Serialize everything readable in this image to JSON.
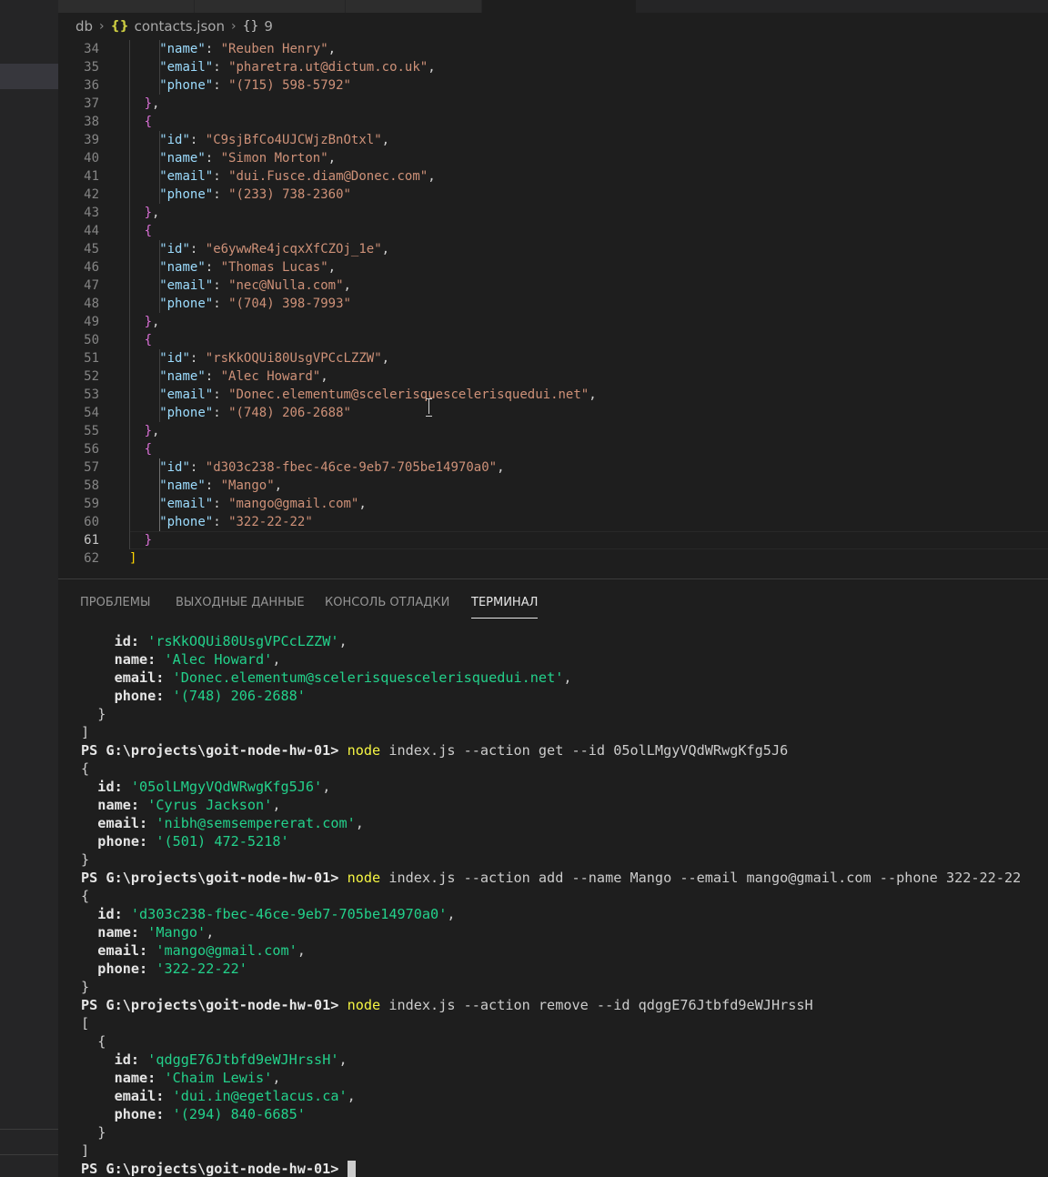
{
  "breadcrumb": {
    "folder": "db",
    "file_icon": "{}",
    "file": "contacts.json",
    "obj_icon": "{}",
    "node": "9"
  },
  "editor": {
    "lines": [
      {
        "n": "34",
        "indent": 4,
        "parts": [
          [
            "k",
            "\"name\""
          ],
          [
            "p",
            ": "
          ],
          [
            "s",
            "\"Reuben Henry\""
          ],
          [
            "p",
            ","
          ]
        ]
      },
      {
        "n": "35",
        "indent": 4,
        "parts": [
          [
            "k",
            "\"email\""
          ],
          [
            "p",
            ": "
          ],
          [
            "s",
            "\"pharetra.ut@dictum.co.uk\""
          ],
          [
            "p",
            ","
          ]
        ]
      },
      {
        "n": "36",
        "indent": 4,
        "parts": [
          [
            "k",
            "\"phone\""
          ],
          [
            "p",
            ": "
          ],
          [
            "s",
            "\"(715) 598-5792\""
          ]
        ]
      },
      {
        "n": "37",
        "indent": 2,
        "parts": [
          [
            "b2",
            "}"
          ],
          [
            "p",
            ","
          ]
        ]
      },
      {
        "n": "38",
        "indent": 2,
        "parts": [
          [
            "b2",
            "{"
          ]
        ]
      },
      {
        "n": "39",
        "indent": 4,
        "parts": [
          [
            "k",
            "\"id\""
          ],
          [
            "p",
            ": "
          ],
          [
            "s",
            "\"C9sjBfCo4UJCWjzBnOtxl\""
          ],
          [
            "p",
            ","
          ]
        ]
      },
      {
        "n": "40",
        "indent": 4,
        "parts": [
          [
            "k",
            "\"name\""
          ],
          [
            "p",
            ": "
          ],
          [
            "s",
            "\"Simon Morton\""
          ],
          [
            "p",
            ","
          ]
        ]
      },
      {
        "n": "41",
        "indent": 4,
        "parts": [
          [
            "k",
            "\"email\""
          ],
          [
            "p",
            ": "
          ],
          [
            "s",
            "\"dui.Fusce.diam@Donec.com\""
          ],
          [
            "p",
            ","
          ]
        ]
      },
      {
        "n": "42",
        "indent": 4,
        "parts": [
          [
            "k",
            "\"phone\""
          ],
          [
            "p",
            ": "
          ],
          [
            "s",
            "\"(233) 738-2360\""
          ]
        ]
      },
      {
        "n": "43",
        "indent": 2,
        "parts": [
          [
            "b2",
            "}"
          ],
          [
            "p",
            ","
          ]
        ]
      },
      {
        "n": "44",
        "indent": 2,
        "parts": [
          [
            "b2",
            "{"
          ]
        ]
      },
      {
        "n": "45",
        "indent": 4,
        "parts": [
          [
            "k",
            "\"id\""
          ],
          [
            "p",
            ": "
          ],
          [
            "s",
            "\"e6ywwRe4jcqxXfCZOj_1e\""
          ],
          [
            "p",
            ","
          ]
        ]
      },
      {
        "n": "46",
        "indent": 4,
        "parts": [
          [
            "k",
            "\"name\""
          ],
          [
            "p",
            ": "
          ],
          [
            "s",
            "\"Thomas Lucas\""
          ],
          [
            "p",
            ","
          ]
        ]
      },
      {
        "n": "47",
        "indent": 4,
        "parts": [
          [
            "k",
            "\"email\""
          ],
          [
            "p",
            ": "
          ],
          [
            "s",
            "\"nec@Nulla.com\""
          ],
          [
            "p",
            ","
          ]
        ]
      },
      {
        "n": "48",
        "indent": 4,
        "parts": [
          [
            "k",
            "\"phone\""
          ],
          [
            "p",
            ": "
          ],
          [
            "s",
            "\"(704) 398-7993\""
          ]
        ]
      },
      {
        "n": "49",
        "indent": 2,
        "parts": [
          [
            "b2",
            "}"
          ],
          [
            "p",
            ","
          ]
        ]
      },
      {
        "n": "50",
        "indent": 2,
        "parts": [
          [
            "b2",
            "{"
          ]
        ]
      },
      {
        "n": "51",
        "indent": 4,
        "parts": [
          [
            "k",
            "\"id\""
          ],
          [
            "p",
            ": "
          ],
          [
            "s",
            "\"rsKkOQUi80UsgVPCcLZZW\""
          ],
          [
            "p",
            ","
          ]
        ]
      },
      {
        "n": "52",
        "indent": 4,
        "parts": [
          [
            "k",
            "\"name\""
          ],
          [
            "p",
            ": "
          ],
          [
            "s",
            "\"Alec Howard\""
          ],
          [
            "p",
            ","
          ]
        ]
      },
      {
        "n": "53",
        "indent": 4,
        "parts": [
          [
            "k",
            "\"email\""
          ],
          [
            "p",
            ": "
          ],
          [
            "s",
            "\"Donec.elementum@scelerisquescelerisquedui.net\""
          ],
          [
            "p",
            ","
          ]
        ]
      },
      {
        "n": "54",
        "indent": 4,
        "parts": [
          [
            "k",
            "\"phone\""
          ],
          [
            "p",
            ": "
          ],
          [
            "s",
            "\"(748) 206-2688\""
          ]
        ]
      },
      {
        "n": "55",
        "indent": 2,
        "parts": [
          [
            "b2",
            "}"
          ],
          [
            "p",
            ","
          ]
        ]
      },
      {
        "n": "56",
        "indent": 2,
        "parts": [
          [
            "b2",
            "{"
          ]
        ]
      },
      {
        "n": "57",
        "indent": 4,
        "parts": [
          [
            "k",
            "\"id\""
          ],
          [
            "p",
            ": "
          ],
          [
            "s",
            "\"d303c238-fbec-46ce-9eb7-705be14970a0\""
          ],
          [
            "p",
            ","
          ]
        ]
      },
      {
        "n": "58",
        "indent": 4,
        "parts": [
          [
            "k",
            "\"name\""
          ],
          [
            "p",
            ": "
          ],
          [
            "s",
            "\"Mango\""
          ],
          [
            "p",
            ","
          ]
        ]
      },
      {
        "n": "59",
        "indent": 4,
        "parts": [
          [
            "k",
            "\"email\""
          ],
          [
            "p",
            ": "
          ],
          [
            "s",
            "\"mango@gmail.com\""
          ],
          [
            "p",
            ","
          ]
        ]
      },
      {
        "n": "60",
        "indent": 4,
        "parts": [
          [
            "k",
            "\"phone\""
          ],
          [
            "p",
            ": "
          ],
          [
            "s",
            "\"322-22-22\""
          ]
        ]
      },
      {
        "n": "61",
        "indent": 2,
        "parts": [
          [
            "b2",
            "}"
          ]
        ]
      },
      {
        "n": "62",
        "indent": 0,
        "parts": [
          [
            "b1",
            "]"
          ]
        ]
      }
    ],
    "current_line": "61"
  },
  "panel": {
    "tabs": [
      {
        "label": "ПРОБЛЕМЫ",
        "active": false
      },
      {
        "label": "ВЫХОДНЫЕ ДАННЫЕ",
        "active": false
      },
      {
        "label": "КОНСОЛЬ ОТЛАДКИ",
        "active": false
      },
      {
        "label": "ТЕРМИНАЛ",
        "active": true
      }
    ]
  },
  "terminal": {
    "lines": [
      [
        [
          "",
          "    "
        ],
        [
          "b",
          "id:"
        ],
        [
          "",
          " "
        ],
        [
          "tg",
          "'rsKkOQUi80UsgVPCcLZZW'"
        ],
        [
          "",
          ","
        ]
      ],
      [
        [
          "",
          "    "
        ],
        [
          "b",
          "name:"
        ],
        [
          "",
          " "
        ],
        [
          "tg",
          "'Alec Howard'"
        ],
        [
          "",
          ","
        ]
      ],
      [
        [
          "",
          "    "
        ],
        [
          "b",
          "email:"
        ],
        [
          "",
          " "
        ],
        [
          "tg",
          "'Donec.elementum@scelerisquescelerisquedui.net'"
        ],
        [
          "",
          ","
        ]
      ],
      [
        [
          "",
          "    "
        ],
        [
          "b",
          "phone:"
        ],
        [
          "",
          " "
        ],
        [
          "tg",
          "'(748) 206-2688'"
        ]
      ],
      [
        [
          "",
          "  }"
        ]
      ],
      [
        [
          "",
          "]"
        ]
      ],
      [
        [
          "tprompt",
          "PS G:\\projects\\goit-node-hw-01>"
        ],
        [
          "",
          " "
        ],
        [
          "ty",
          "node"
        ],
        [
          "",
          " index.js --action get --id 05olLMgyVQdWRwgKfg5J6"
        ]
      ],
      [
        [
          "",
          "{"
        ]
      ],
      [
        [
          "",
          "  "
        ],
        [
          "b",
          "id:"
        ],
        [
          "",
          " "
        ],
        [
          "tg",
          "'05olLMgyVQdWRwgKfg5J6'"
        ],
        [
          "",
          ","
        ]
      ],
      [
        [
          "",
          "  "
        ],
        [
          "b",
          "name:"
        ],
        [
          "",
          " "
        ],
        [
          "tg",
          "'Cyrus Jackson'"
        ],
        [
          "",
          ","
        ]
      ],
      [
        [
          "",
          "  "
        ],
        [
          "b",
          "email:"
        ],
        [
          "",
          " "
        ],
        [
          "tg",
          "'nibh@semsempererat.com'"
        ],
        [
          "",
          ","
        ]
      ],
      [
        [
          "",
          "  "
        ],
        [
          "b",
          "phone:"
        ],
        [
          "",
          " "
        ],
        [
          "tg",
          "'(501) 472-5218'"
        ]
      ],
      [
        [
          "",
          "}"
        ]
      ],
      [
        [
          "tprompt",
          "PS G:\\projects\\goit-node-hw-01>"
        ],
        [
          "",
          " "
        ],
        [
          "ty",
          "node"
        ],
        [
          "",
          " index.js --action add --name Mango --email mango@gmail.com --phone 322-22-22"
        ]
      ],
      [
        [
          "",
          "{"
        ]
      ],
      [
        [
          "",
          "  "
        ],
        [
          "b",
          "id:"
        ],
        [
          "",
          " "
        ],
        [
          "tg",
          "'d303c238-fbec-46ce-9eb7-705be14970a0'"
        ],
        [
          "",
          ","
        ]
      ],
      [
        [
          "",
          "  "
        ],
        [
          "b",
          "name:"
        ],
        [
          "",
          " "
        ],
        [
          "tg",
          "'Mango'"
        ],
        [
          "",
          ","
        ]
      ],
      [
        [
          "",
          "  "
        ],
        [
          "b",
          "email:"
        ],
        [
          "",
          " "
        ],
        [
          "tg",
          "'mango@gmail.com'"
        ],
        [
          "",
          ","
        ]
      ],
      [
        [
          "",
          "  "
        ],
        [
          "b",
          "phone:"
        ],
        [
          "",
          " "
        ],
        [
          "tg",
          "'322-22-22'"
        ]
      ],
      [
        [
          "",
          "}"
        ]
      ],
      [
        [
          "tprompt",
          "PS G:\\projects\\goit-node-hw-01>"
        ],
        [
          "",
          " "
        ],
        [
          "ty",
          "node"
        ],
        [
          "",
          " index.js --action remove --id qdggE76Jtbfd9eWJHrssH"
        ]
      ],
      [
        [
          "",
          "["
        ]
      ],
      [
        [
          "",
          "  {"
        ]
      ],
      [
        [
          "",
          "    "
        ],
        [
          "b",
          "id:"
        ],
        [
          "",
          " "
        ],
        [
          "tg",
          "'qdggE76Jtbfd9eWJHrssH'"
        ],
        [
          "",
          ","
        ]
      ],
      [
        [
          "",
          "    "
        ],
        [
          "b",
          "name:"
        ],
        [
          "",
          " "
        ],
        [
          "tg",
          "'Chaim Lewis'"
        ],
        [
          "",
          ","
        ]
      ],
      [
        [
          "",
          "    "
        ],
        [
          "b",
          "email:"
        ],
        [
          "",
          " "
        ],
        [
          "tg",
          "'dui.in@egetlacus.ca'"
        ],
        [
          "",
          ","
        ]
      ],
      [
        [
          "",
          "    "
        ],
        [
          "b",
          "phone:"
        ],
        [
          "",
          " "
        ],
        [
          "tg",
          "'(294) 840-6685'"
        ]
      ],
      [
        [
          "",
          "  }"
        ]
      ],
      [
        [
          "",
          "]"
        ]
      ],
      [
        [
          "tprompt",
          "PS G:\\projects\\goit-node-hw-01>"
        ],
        [
          "",
          " "
        ],
        [
          "cursor",
          ""
        ]
      ]
    ]
  },
  "colors": {
    "background": "#1e1e1e",
    "json_key": "#9cdcfe",
    "json_string": "#ce9178",
    "bracket_outer": "#ffd700",
    "bracket_inner": "#da70d6",
    "terminal_string": "#23d18b",
    "terminal_command": "#f5f543"
  }
}
